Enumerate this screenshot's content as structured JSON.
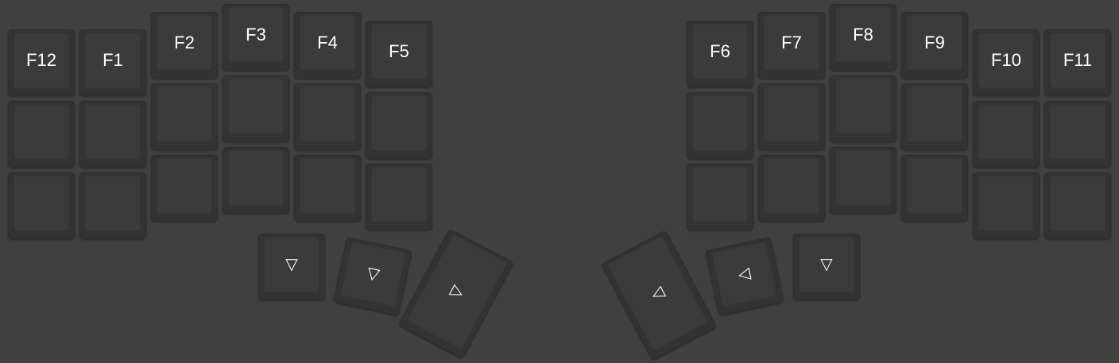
{
  "keyboard": {
    "colors": {
      "background": "#404040",
      "keycap": "#3b3b3b",
      "keycap_edge": "#333333",
      "legend": "#ffffff"
    },
    "left": {
      "rows": [
        [
          "F12",
          "F1",
          "F2",
          "F3",
          "F4",
          "F5"
        ],
        [
          "",
          "",
          "",
          "",
          "",
          ""
        ],
        [
          "",
          "",
          "",
          "",
          "",
          ""
        ]
      ],
      "thumbs": [
        "▽",
        "▽",
        "▷"
      ]
    },
    "right": {
      "rows": [
        [
          "F6",
          "F7",
          "F8",
          "F9",
          "F10",
          "F11"
        ],
        [
          "",
          "",
          "",
          "",
          "",
          ""
        ],
        [
          "",
          "",
          "",
          "",
          "",
          ""
        ]
      ],
      "thumbs": [
        "◁",
        "◁",
        "▽"
      ]
    }
  }
}
